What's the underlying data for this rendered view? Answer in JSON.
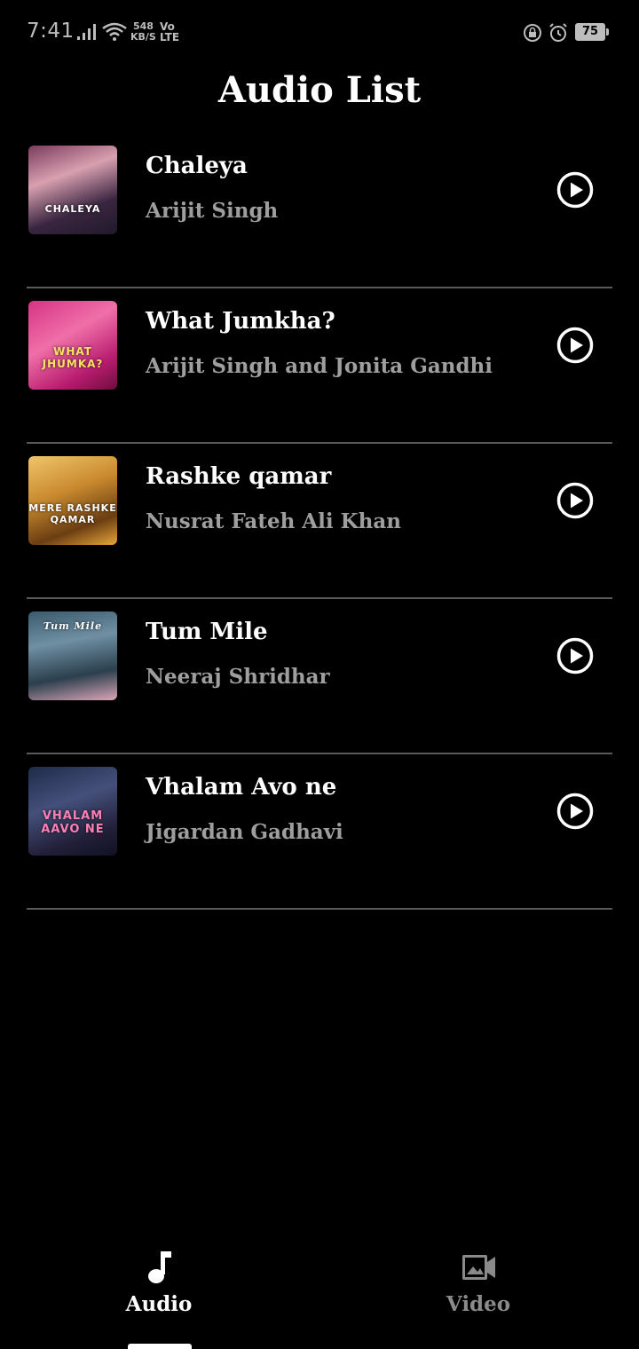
{
  "status_bar": {
    "time": "7:41",
    "net_speed_value": "548",
    "net_speed_unit": "KB/S",
    "volte_top": "Vo",
    "volte_bottom": "LTE",
    "battery": "75"
  },
  "header": {
    "title": "Audio List"
  },
  "songs": [
    {
      "title": "Chaleya",
      "artist": "Arijit Singh",
      "cover_text": "CHALEYA"
    },
    {
      "title": "What Jumkha?",
      "artist": "Arijit Singh and Jonita Gandhi",
      "cover_text": "WHAT JHUMKA?"
    },
    {
      "title": "Rashke qamar",
      "artist": "Nusrat Fateh Ali Khan",
      "cover_text": "MERE RASHKE QAMAR"
    },
    {
      "title": "Tum Mile",
      "artist": "Neeraj Shridhar",
      "cover_text": "Tum Mile"
    },
    {
      "title": "Vhalam Avo ne",
      "artist": "Jigardan Gadhavi",
      "cover_text": "VHALAM AAVO NE"
    }
  ],
  "bottom_nav": {
    "audio_label": "Audio",
    "video_label": "Video",
    "active": "audio"
  },
  "colors": {
    "background": "#000000",
    "title_text": "#ffffff",
    "artist_text": "#9e9e9e",
    "divider": "#5a5a5a",
    "inactive_nav": "#8a8a8a"
  },
  "icons": {
    "play": "play-circle-icon",
    "audio_nav": "music-note-icon",
    "video_nav": "video-camera-icon"
  }
}
